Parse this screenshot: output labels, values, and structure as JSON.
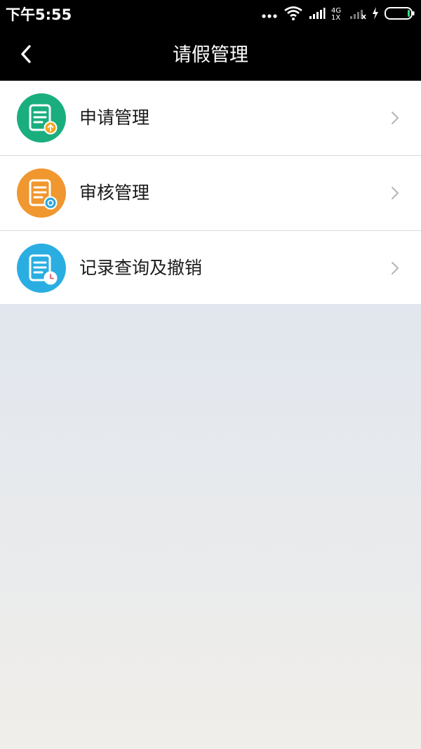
{
  "status_bar": {
    "time": "下午5:55",
    "network_type": "4G",
    "sim_slot": "1X"
  },
  "header": {
    "title": "请假管理"
  },
  "menu": {
    "items": [
      {
        "label": "申请管理",
        "icon": "leave-application-icon",
        "color": "#1aae7e",
        "badge_color": "#f5a623"
      },
      {
        "label": "审核管理",
        "icon": "leave-review-icon",
        "color": "#f0972f",
        "badge_color": "#2ba7df"
      },
      {
        "label": "记录查询及撤销",
        "icon": "leave-records-icon",
        "color": "#2aaee2",
        "badge_color": "#e25b6a"
      }
    ]
  },
  "colors": {
    "bar_background": "#000000",
    "item_background": "#ffffff",
    "divider": "#dadada",
    "chevron": "#b5b5b5"
  }
}
